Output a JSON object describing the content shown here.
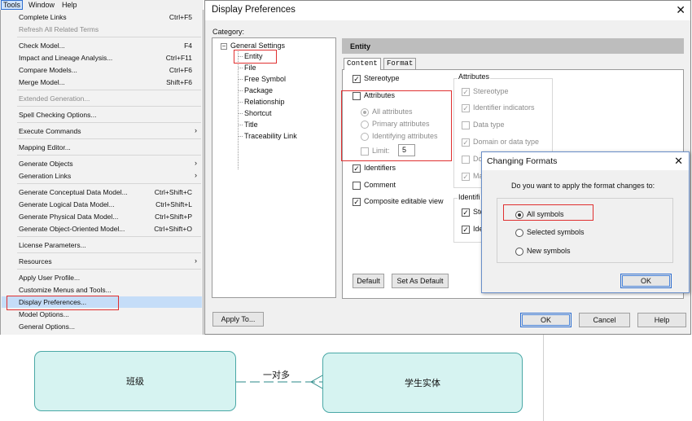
{
  "menubar": {
    "tools": "Tools",
    "window": "Window",
    "help": "Help"
  },
  "tools_menu": {
    "items": [
      {
        "label": "Complete Links",
        "shortcut": "Ctrl+F5"
      },
      {
        "label": "Refresh All Related Terms",
        "shortcut": ""
      },
      {
        "label": "Check Model...",
        "shortcut": "F4"
      },
      {
        "label": "Impact and Lineage Analysis...",
        "shortcut": "Ctrl+F11"
      },
      {
        "label": "Compare Models...",
        "shortcut": "Ctrl+F6"
      },
      {
        "label": "Merge Model...",
        "shortcut": "Shift+F6"
      },
      {
        "label": "Extended Generation...",
        "shortcut": ""
      },
      {
        "label": "Spell Checking Options...",
        "shortcut": ""
      },
      {
        "label": "Execute Commands",
        "shortcut": ""
      },
      {
        "label": "Mapping Editor...",
        "shortcut": ""
      },
      {
        "label": "Generate Objects",
        "shortcut": ""
      },
      {
        "label": "Generation Links",
        "shortcut": ""
      },
      {
        "label": "Generate Conceptual Data Model...",
        "shortcut": "Ctrl+Shift+C"
      },
      {
        "label": "Generate Logical Data Model...",
        "shortcut": "Ctrl+Shift+L"
      },
      {
        "label": "Generate Physical Data Model...",
        "shortcut": "Ctrl+Shift+P"
      },
      {
        "label": "Generate Object-Oriented Model...",
        "shortcut": "Ctrl+Shift+O"
      },
      {
        "label": "License Parameters...",
        "shortcut": ""
      },
      {
        "label": "Resources",
        "shortcut": ""
      },
      {
        "label": "Apply User Profile...",
        "shortcut": ""
      },
      {
        "label": "Customize Menus and Tools...",
        "shortcut": ""
      },
      {
        "label": "Display Preferences...",
        "shortcut": ""
      },
      {
        "label": "Model Options...",
        "shortcut": ""
      },
      {
        "label": "General Options...",
        "shortcut": ""
      }
    ],
    "submenu_arrow": "›"
  },
  "display_prefs": {
    "title": "Display Preferences",
    "close": "✕",
    "category_label": "Category:",
    "tree": {
      "root": "General Settings",
      "children": [
        "Entity",
        "File",
        "Free Symbol",
        "Package",
        "Relationship",
        "Shortcut",
        "Title",
        "Traceability Link"
      ]
    },
    "header": "Entity",
    "tabs": [
      "Content",
      "Format"
    ],
    "left_options": {
      "stereotype": "Stereotype",
      "attributes": "Attributes",
      "all_attributes": "All attributes",
      "primary_attributes": "Primary attributes",
      "identifying_attributes": "Identifying attributes",
      "limit": "Limit:",
      "limit_value": "5",
      "identifiers": "Identifiers",
      "comment": "Comment",
      "composite": "Composite editable view"
    },
    "attributes_group": {
      "title": "Attributes",
      "stereotype": "Stereotype",
      "identifier_indicators": "Identifier indicators",
      "data_type": "Data type",
      "domain_or_data_type": "Domain or data type",
      "do_partial": "Do",
      "ma_partial": "Ma"
    },
    "identifiers_group": {
      "title": "Identifi",
      "ste_partial": "Ste",
      "ide_partial": "Ide"
    },
    "buttons": {
      "default": "Default",
      "set_as_default": "Set As Default",
      "apply_to": "Apply To...",
      "ok": "OK",
      "cancel": "Cancel",
      "help": "Help"
    },
    "check_mark": "✓"
  },
  "changing_formats": {
    "title": "Changing Formats",
    "close": "✕",
    "question": "Do you want to apply the format changes to:",
    "options": [
      "All symbols",
      "Selected symbols",
      "New symbols"
    ],
    "ok": "OK"
  },
  "diagram": {
    "entity_left": "班级",
    "entity_right": "学生实体",
    "relationship_label": "一对多"
  }
}
